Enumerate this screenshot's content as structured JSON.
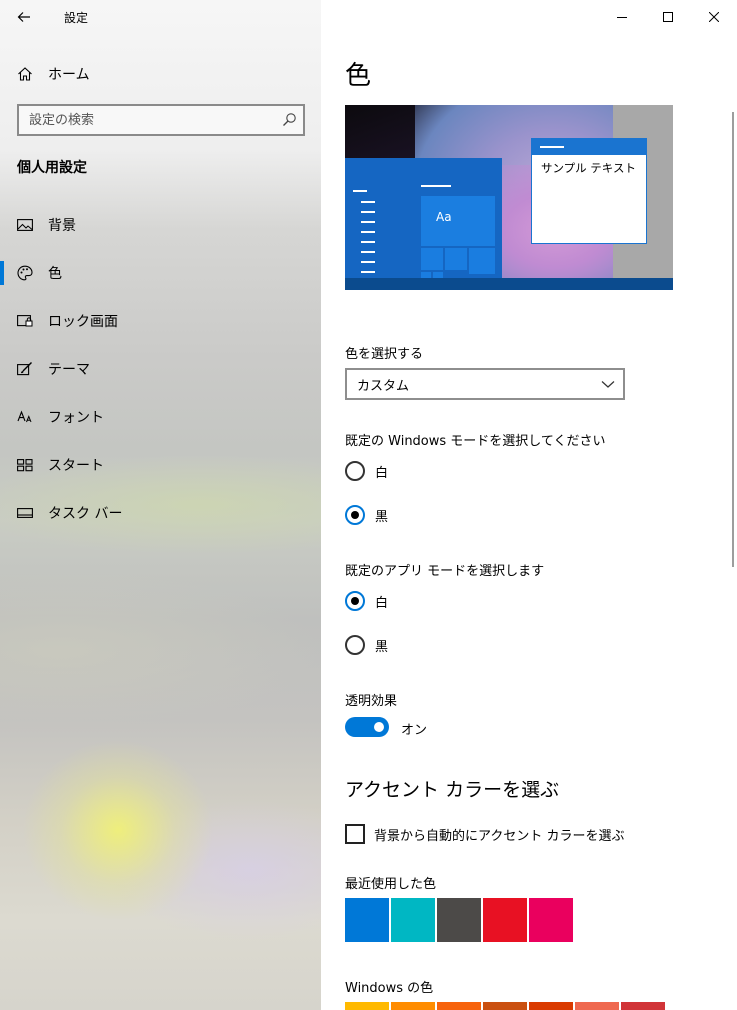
{
  "window": {
    "app_title": "設定"
  },
  "sidebar": {
    "home_label": "ホーム",
    "search_placeholder": "設定の検索",
    "section_title": "個人用設定",
    "items": [
      {
        "label": "背景",
        "icon": "picture-icon",
        "active": false
      },
      {
        "label": "色",
        "icon": "palette-icon",
        "active": true
      },
      {
        "label": "ロック画面",
        "icon": "lock-screen-icon",
        "active": false
      },
      {
        "label": "テーマ",
        "icon": "theme-brush-icon",
        "active": false
      },
      {
        "label": "フォント",
        "icon": "font-icon",
        "active": false
      },
      {
        "label": "スタート",
        "icon": "start-grid-icon",
        "active": false
      },
      {
        "label": "タスク バー",
        "icon": "taskbar-icon",
        "active": false
      }
    ]
  },
  "main": {
    "page_title": "色",
    "preview": {
      "sample_text": "サンプル テキスト",
      "tile_text": "Aa"
    },
    "choose_color": {
      "label": "色を選択する",
      "value": "カスタム"
    },
    "windows_mode": {
      "label": "既定の Windows モードを選択してください",
      "options": [
        {
          "label": "白",
          "checked": false
        },
        {
          "label": "黒",
          "checked": true
        }
      ]
    },
    "app_mode": {
      "label": "既定のアプリ モードを選択します",
      "options": [
        {
          "label": "白",
          "checked": true
        },
        {
          "label": "黒",
          "checked": false
        }
      ]
    },
    "transparency": {
      "label": "透明効果",
      "state_label": "オン",
      "on": true
    },
    "accent": {
      "heading": "アクセント カラーを選ぶ",
      "auto_checkbox_label": "背景から自動的にアクセント カラーを選ぶ",
      "auto_checked": false,
      "recent_label": "最近使用した色",
      "recent_colors": [
        "#0078d7",
        "#00b7c3",
        "#4c4a48",
        "#e81123",
        "#ea005e"
      ],
      "windows_colors_label": "Windows の色",
      "windows_colors": [
        "#ffb900",
        "#ff8c00",
        "#f7630c",
        "#ca5010",
        "#da3b01",
        "#ef6950",
        "#d13438"
      ]
    }
  },
  "colors": {
    "accent": "#0078d7"
  }
}
